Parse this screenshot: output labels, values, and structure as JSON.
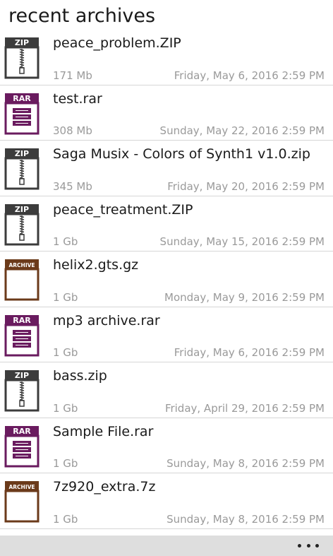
{
  "header": {
    "title": "recent archives"
  },
  "colors": {
    "zip": "#3c3c3c",
    "rar": "#6a1b5f",
    "archive": "#6b3a1a",
    "appbar": "#dedede",
    "meta_text": "#9a9a9a"
  },
  "items": [
    {
      "type": "zip",
      "badge": "ZIP",
      "name": "peace_problem.ZIP",
      "size": "171 Mb",
      "date": "Friday, May 6, 2016 2:59 PM"
    },
    {
      "type": "rar",
      "badge": "RAR",
      "name": "test.rar",
      "size": "308 Mb",
      "date": "Sunday, May 22, 2016 2:59 PM"
    },
    {
      "type": "zip",
      "badge": "ZIP",
      "name": "Saga Musix - Colors of Synth1 v1.0.zip",
      "size": "345 Mb",
      "date": "Friday, May 20, 2016 2:59 PM"
    },
    {
      "type": "zip",
      "badge": "ZIP",
      "name": "peace_treatment.ZIP",
      "size": "1 Gb",
      "date": "Sunday, May 15, 2016 2:59 PM"
    },
    {
      "type": "archive",
      "badge": "ARCHIVE",
      "name": "helix2.gts.gz",
      "size": "1 Gb",
      "date": "Monday, May 9, 2016 2:59 PM"
    },
    {
      "type": "rar",
      "badge": "RAR",
      "name": "mp3 archive.rar",
      "size": "1 Gb",
      "date": "Friday, May 6, 2016 2:59 PM"
    },
    {
      "type": "zip",
      "badge": "ZIP",
      "name": "bass.zip",
      "size": "1 Gb",
      "date": "Friday, April 29, 2016 2:59 PM"
    },
    {
      "type": "rar",
      "badge": "RAR",
      "name": "Sample File.rar",
      "size": "1 Gb",
      "date": "Sunday, May 8, 2016 2:59 PM"
    },
    {
      "type": "archive",
      "badge": "ARCHIVE",
      "name": "7z920_extra.7z",
      "size": "1 Gb",
      "date": "Sunday, May 8, 2016 2:59 PM"
    }
  ],
  "appbar": {
    "more_icon": "ellipsis-icon"
  }
}
